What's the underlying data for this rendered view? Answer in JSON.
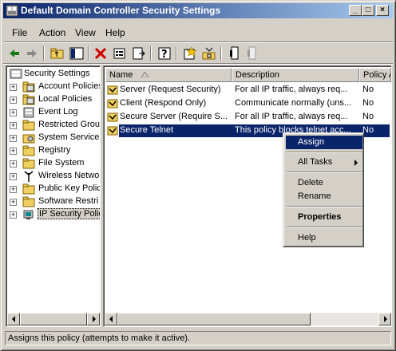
{
  "window": {
    "title": "Default Domain Controller Security Settings",
    "controls": {
      "minimize": "_",
      "maximize": "□",
      "close": "×"
    }
  },
  "menu": [
    {
      "label": "File",
      "icon": null
    },
    {
      "label": "Action"
    },
    {
      "label": "View"
    },
    {
      "label": "Help"
    }
  ],
  "toolbar": {
    "icons": [
      "back-icon",
      "forward-icon",
      "up-folder-icon",
      "show-hide-tree-icon",
      "delete-icon",
      "properties-icon",
      "export-list-icon",
      "help-icon",
      "add-policy-icon",
      "manage-filters-icon",
      "assign-icon",
      "unassign-icon"
    ]
  },
  "tree": {
    "root": "Security Settings",
    "items": [
      {
        "label": "Account Policies",
        "icon": "policy-folder-icon"
      },
      {
        "label": "Local Policies",
        "icon": "policy-folder-icon"
      },
      {
        "label": "Event Log",
        "icon": "event-log-icon"
      },
      {
        "label": "Restricted Grou",
        "icon": "folder-icon"
      },
      {
        "label": "System Services",
        "icon": "services-icon"
      },
      {
        "label": "Registry",
        "icon": "folder-icon"
      },
      {
        "label": "File System",
        "icon": "folder-icon"
      },
      {
        "label": "Wireless Netwo",
        "icon": "antenna-icon"
      },
      {
        "label": "Public Key Polici",
        "icon": "folder-icon"
      },
      {
        "label": "Software Restri",
        "icon": "folder-icon"
      },
      {
        "label": "IP Security Polic",
        "icon": "ip-security-icon",
        "selected": true
      }
    ]
  },
  "list": {
    "columns": [
      "Name",
      "Description",
      "Policy A"
    ],
    "rows": [
      {
        "name": "Server (Request Security)",
        "description": "For all IP traffic, always req...",
        "assigned": "No"
      },
      {
        "name": "Client (Respond Only)",
        "description": "Communicate normally (uns...",
        "assigned": "No"
      },
      {
        "name": "Secure Server (Require S...",
        "description": "For all IP traffic, always req...",
        "assigned": "No"
      },
      {
        "name": "Secure Telnet",
        "description": "This policy blocks telnet acc...",
        "assigned": "No",
        "selected": true
      }
    ]
  },
  "context_menu": {
    "items": [
      {
        "label": "Assign",
        "highlighted": true
      },
      {
        "label": "All Tasks",
        "submenu": true
      },
      {
        "label": "Delete"
      },
      {
        "label": "Rename"
      },
      {
        "label": "Properties",
        "bold": true
      },
      {
        "label": "Help"
      }
    ]
  },
  "status": "Assigns this policy (attempts to make it active).",
  "colors": {
    "selection": "#0a246a",
    "title_gradient_end": "#a6caf0",
    "face": "#d4d0c8"
  }
}
